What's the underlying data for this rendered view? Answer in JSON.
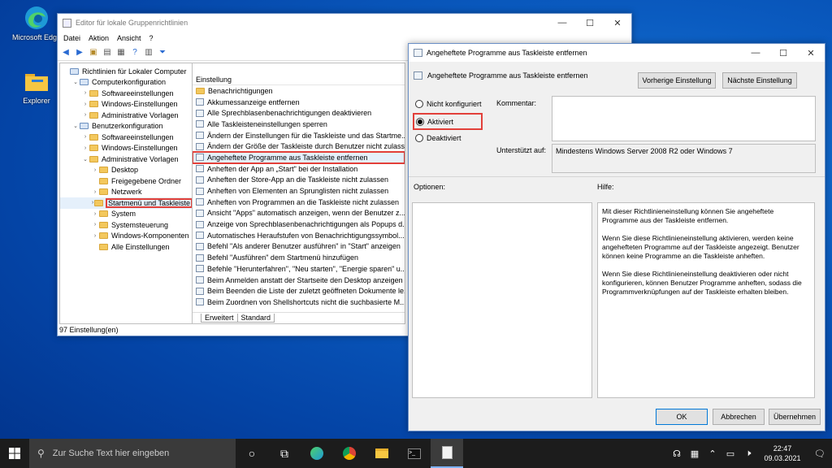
{
  "desktop": {
    "edge_label": "Microsoft Edge",
    "explorer_label": "Explorer"
  },
  "gpedit": {
    "title": "Editor für lokale Gruppenrichtlinien",
    "menu": [
      "Datei",
      "Aktion",
      "Ansicht",
      "?"
    ],
    "tree": [
      {
        "label": "Richtlinien für Lokaler Computer",
        "indent": 0,
        "twisty": ""
      },
      {
        "label": "Computerkonfiguration",
        "indent": 1,
        "twisty": "v"
      },
      {
        "label": "Softwareeinstellungen",
        "indent": 2,
        "twisty": ">"
      },
      {
        "label": "Windows-Einstellungen",
        "indent": 2,
        "twisty": ">"
      },
      {
        "label": "Administrative Vorlagen",
        "indent": 2,
        "twisty": ">"
      },
      {
        "label": "Benutzerkonfiguration",
        "indent": 1,
        "twisty": "v"
      },
      {
        "label": "Softwareeinstellungen",
        "indent": 2,
        "twisty": ">"
      },
      {
        "label": "Windows-Einstellungen",
        "indent": 2,
        "twisty": ">"
      },
      {
        "label": "Administrative Vorlagen",
        "indent": 2,
        "twisty": "v"
      },
      {
        "label": "Desktop",
        "indent": 3,
        "twisty": ">"
      },
      {
        "label": "Freigegebene Ordner",
        "indent": 3,
        "twisty": ""
      },
      {
        "label": "Netzwerk",
        "indent": 3,
        "twisty": ">"
      },
      {
        "label": "Startmenü und Taskleiste",
        "indent": 3,
        "twisty": ">"
      },
      {
        "label": "System",
        "indent": 3,
        "twisty": ">"
      },
      {
        "label": "Systemsteuerung",
        "indent": 3,
        "twisty": ">"
      },
      {
        "label": "Windows-Komponenten",
        "indent": 3,
        "twisty": ">"
      },
      {
        "label": "Alle Einstellungen",
        "indent": 3,
        "twisty": ""
      }
    ],
    "column_header": "Einstellung",
    "settings": [
      "Benachrichtigungen",
      "Akkumessanzeige entfernen",
      "Alle Sprechblasenbenachrichtigungen deaktivieren",
      "Alle Taskleisteneinstellungen sperren",
      "Ändern der Einstellungen für die Taskleiste und das Startme...",
      "Ändern der Größe der Taskleiste durch Benutzer nicht zulassen",
      "Angeheftete Programme aus Taskleiste entfernen",
      "Anheften der App an „Start\" bei der Installation",
      "Anheften der Store-App an die Taskleiste nicht zulassen",
      "Anheften von Elementen an Sprunglisten nicht zulassen",
      "Anheften von Programmen an die Taskleiste nicht zulassen",
      "Ansicht \"Apps\" automatisch anzeigen, wenn der Benutzer z...",
      "Anzeige von Sprechblasenbenachrichtigungen als Popups d...",
      "Automatisches Heraufstufen von Benachrichtigungssymbol...",
      "Befehl \"Als anderer Benutzer ausführen\" in \"Start\" anzeigen",
      "Befehl \"Ausführen\" dem Startmenü hinzufügen",
      "Befehle \"Herunterfahren\", \"Neu starten\", \"Energie sparen\" u...",
      "Beim Anmelden anstatt der Startseite den Desktop anzeigen",
      "Beim Beenden die Liste der zuletzt geöffneten Dokumente le...",
      "Beim Zuordnen von Shellshortcuts nicht die suchbasierte M..."
    ],
    "tabs": [
      "Erweitert",
      "Standard"
    ],
    "status": "97 Einstellung(en)"
  },
  "dialog": {
    "title": "Angeheftete Programme aus Taskleiste entfernen",
    "heading": "Angeheftete Programme aus Taskleiste entfernen",
    "prev_button": "Vorherige Einstellung",
    "next_button": "Nächste Einstellung",
    "options": [
      "Nicht konfiguriert",
      "Aktiviert",
      "Deaktiviert"
    ],
    "comment_label": "Kommentar:",
    "supported_label": "Unterstützt auf:",
    "supported_value": "Mindestens Windows Server 2008 R2 oder Windows 7",
    "options_label": "Optionen:",
    "help_label": "Hilfe:",
    "help_p1": "Mit dieser Richtlinieneinstellung können Sie angeheftete Programme aus der Taskleiste entfernen.",
    "help_p2": "Wenn Sie diese Richtlinieneinstellung aktivieren, werden keine angehefteten Programme auf der Taskleiste angezeigt. Benutzer können keine Programme an die Taskleiste anheften.",
    "help_p3": "Wenn Sie diese Richtlinieneinstellung deaktivieren oder nicht konfigurieren, können Benutzer Programme anheften, sodass die Programmverknüpfungen auf der Taskleiste erhalten bleiben.",
    "ok": "OK",
    "cancel": "Abbrechen",
    "apply": "Übernehmen"
  },
  "taskbar": {
    "search_placeholder": "Zur Suche Text hier eingeben",
    "time": "22:47",
    "date": "09.03.2021"
  }
}
